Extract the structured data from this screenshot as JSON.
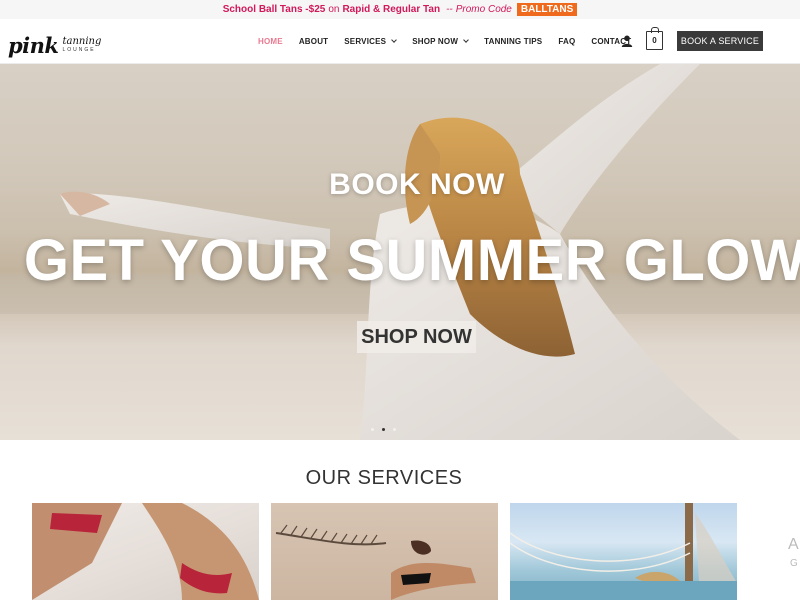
{
  "promo": {
    "part1": "School Ball Tans - ",
    "price": "$25",
    "on": "on",
    "part2": "Rapid & Regular Tan",
    "sep": "--",
    "code_label": "Promo Code",
    "code": "BALLTANS"
  },
  "logo": {
    "main": "pink",
    "sub": "tanning",
    "sub2": "LOUNGE"
  },
  "nav": {
    "home": "HOME",
    "about": "ABOUT",
    "services": "SERVICES",
    "shop_now": "SHOP NOW",
    "tanning_tips": "TANNING TIPS",
    "faq": "FAQ",
    "contact": "CONTACT"
  },
  "cart": {
    "count": "0"
  },
  "header": {
    "book_button": "BOOK A SERVICE"
  },
  "hero": {
    "kicker": "BOOK NOW",
    "title": "GET YOUR SUMMER GLOW",
    "cta": "SHOP NOW",
    "slides_total": 3,
    "slide_active": 2
  },
  "services": {
    "title": "OUR SERVICES",
    "peek_a": "A",
    "peek_b": "G"
  },
  "colors": {
    "accent_pink": "#d1185a",
    "nav_active": "#e87a90",
    "promo_code_bg": "#f06a1d",
    "button_dark": "#3a3a3a"
  },
  "icons": [
    "user-icon",
    "cart-icon",
    "chevron-down-icon"
  ]
}
